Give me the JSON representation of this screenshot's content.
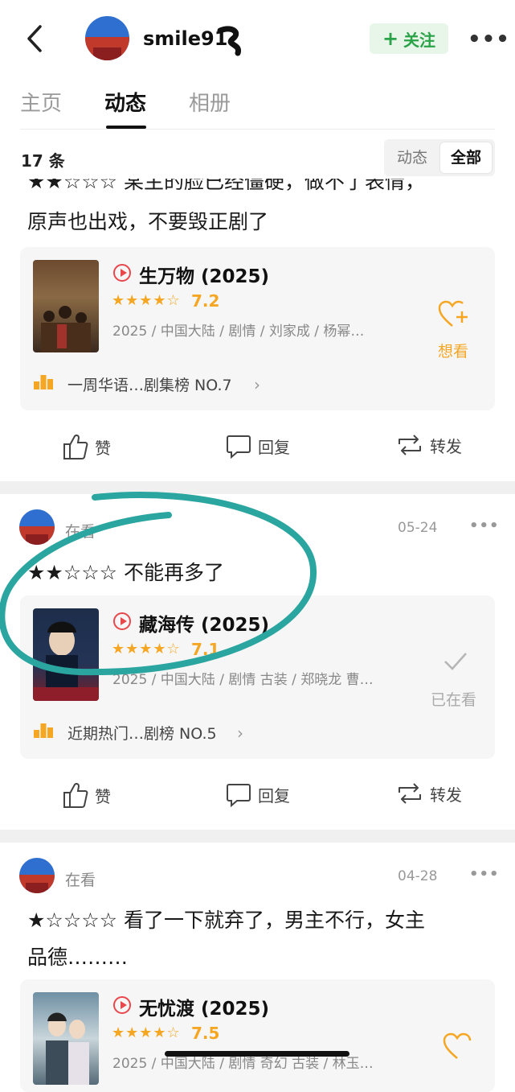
{
  "header": {
    "username": "smile91",
    "follow_label": "关注",
    "more_label": "•••"
  },
  "tabs": [
    {
      "label": "主页"
    },
    {
      "label": "动态"
    },
    {
      "label": "相册"
    }
  ],
  "filter": {
    "count_label": "17 条",
    "options": [
      "动态",
      "全部"
    ],
    "selected": "全部"
  },
  "posts": [
    {
      "text_line1": "★★☆☆☆ 某主的脸已经僵硬，做不了表情，",
      "text_line2": "原声也出戏，不要毁正剧了",
      "movie": {
        "title": "生万物 (2025)",
        "stars_display": "★★★★☆",
        "rating": "7.2",
        "meta": "2025 / 中国大陆 / 剧情 / 刘家成 / 杨幂…",
        "action_label": "想看",
        "rank_text": "一周华语…剧集榜 NO.7"
      },
      "actions": {
        "like": "赞",
        "reply": "回复",
        "repost": "转发"
      }
    },
    {
      "status": "在看",
      "date": "05-24",
      "text_line1": "★★☆☆☆ 不能再多了",
      "movie": {
        "title": "藏海传 (2025)",
        "stars_display": "★★★★☆",
        "rating": "7.1",
        "meta": "2025 / 中国大陆 / 剧情 古装 / 郑晓龙 曹…",
        "action_label": "已在看",
        "rank_text": "近期热门…剧榜 NO.5"
      },
      "actions": {
        "like": "赞",
        "reply": "回复",
        "repost": "转发"
      }
    },
    {
      "status": "在看",
      "date": "04-28",
      "text_line1": "★☆☆☆☆ 看了一下就弃了，男主不行，女主",
      "text_line2": "品德………",
      "movie": {
        "title": "无忧渡 (2025)",
        "stars_display": "★★★★☆",
        "rating": "7.5",
        "meta": "2025 / 中国大陆 / 剧情 奇幻 古装 / 林玉…"
      }
    }
  ],
  "colors": {
    "accent_green": "#2aa248",
    "star_orange": "#f5a623",
    "play_red": "#e8474c",
    "circle_annotation": "#2aa5a0"
  }
}
